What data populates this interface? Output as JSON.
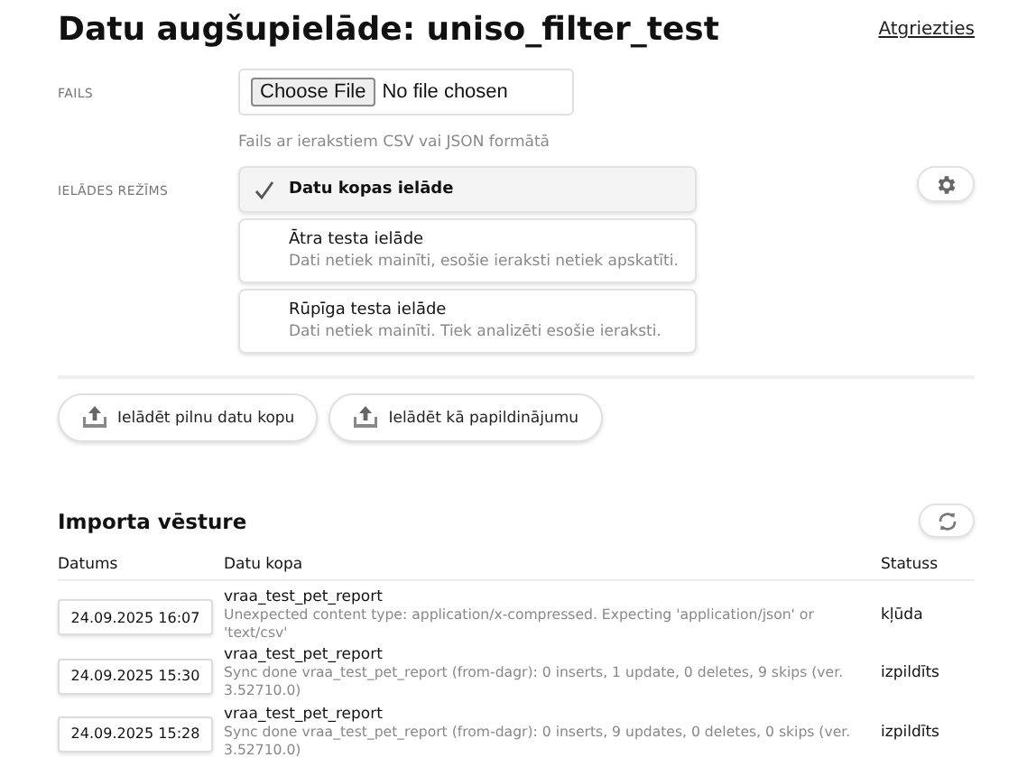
{
  "title": "Datu augšupielāde: uniso_filter_test",
  "back_link": "Atgriezties",
  "file": {
    "label": "FAILS",
    "button": "Choose File",
    "status": "No file chosen",
    "hint": "Fails ar ierakstiem CSV vai JSON formātā"
  },
  "mode": {
    "label": "IELĀDES REŽĪMS",
    "options": [
      {
        "title": "Datu kopas ielāde",
        "selected": true
      },
      {
        "title": "Ātra testa ielāde",
        "description": "Dati netiek mainīti, esošie ieraksti netiek apskatīti.",
        "selected": false
      },
      {
        "title": "Rūpīga testa ielāde",
        "description": "Dati netiek mainīti. Tiek analizēti esošie ieraksti.",
        "selected": false
      }
    ]
  },
  "actions": [
    "Ielādēt pilnu datu kopu",
    "Ielādēt kā papildinājumu"
  ],
  "history": {
    "title": "Importa vēsture",
    "columns": [
      "Datums",
      "Datu kopa",
      "Statuss"
    ],
    "rows": [
      {
        "date": "24.09.2025 16:07",
        "dataset": "vraa_test_pet_report",
        "message": "Unexpected content type: application/x-compressed. Expecting 'application/json' or 'text/csv'",
        "status": "kļūda"
      },
      {
        "date": "24.09.2025 15:30",
        "dataset": "vraa_test_pet_report",
        "message": "Sync done vraa_test_pet_report (from-dagr): 0 inserts, 1 update, 0 deletes, 9 skips (ver. 3.52710.0)",
        "status": "izpildīts"
      },
      {
        "date": "24.09.2025 15:28",
        "dataset": "vraa_test_pet_report",
        "message": "Sync done vraa_test_pet_report (from-dagr): 0 inserts, 9 updates, 0 deletes, 0 skips (ver. 3.52710.0)",
        "status": "izpildīts"
      }
    ]
  }
}
